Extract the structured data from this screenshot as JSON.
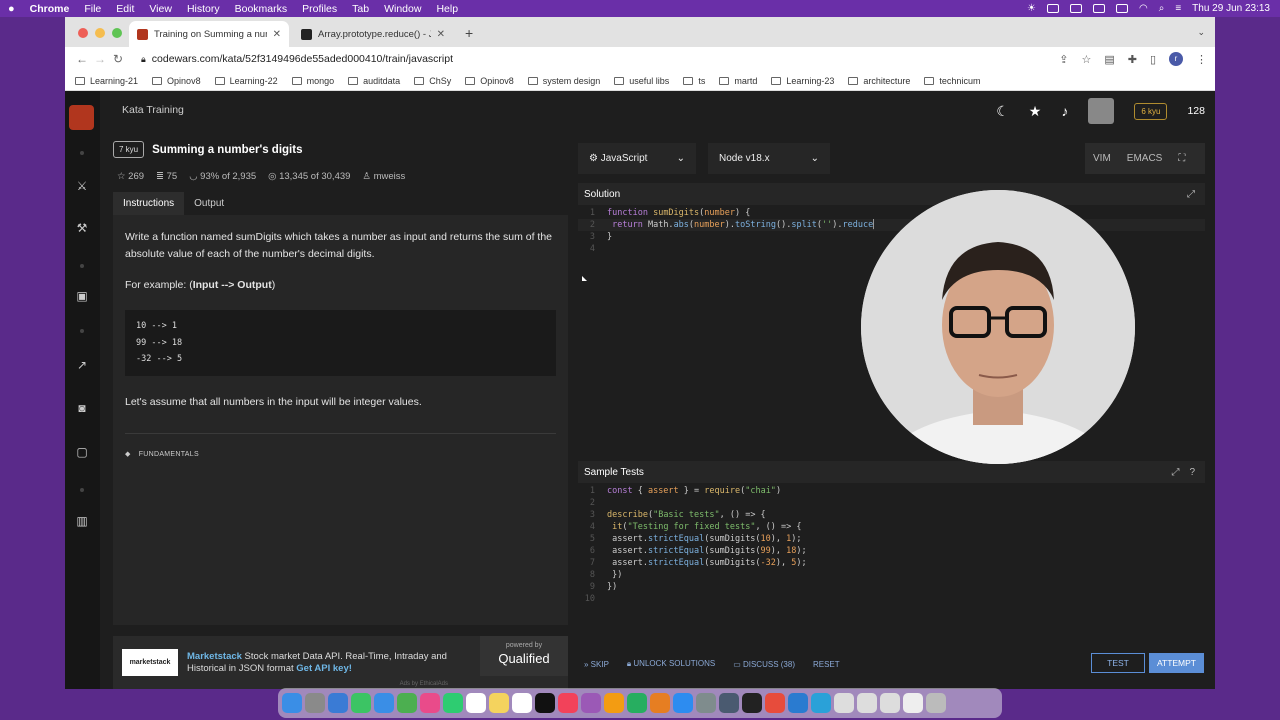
{
  "menubar": {
    "apple": "",
    "app": "Chrome",
    "items": [
      "File",
      "Edit",
      "View",
      "History",
      "Bookmarks",
      "Profiles",
      "Tab",
      "Window",
      "Help"
    ],
    "datetime": "Thu 29 Jun  23:13"
  },
  "tabs": [
    {
      "title": "Training on Summing a number",
      "active": true,
      "color": "#b1361e"
    },
    {
      "title": "Array.prototype.reduce() - Jav",
      "active": false,
      "color": "#222222"
    }
  ],
  "url": "codewars.com/kata/52f3149496de55aded000410/train/javascript",
  "profile_initial": "r",
  "bookmarks": [
    "Learning-21",
    "Opinov8",
    "Learning-22",
    "mongo",
    "auditdata",
    "ChSy",
    "Opinov8",
    "system design",
    "useful libs",
    "ts",
    "martd",
    "Learning-23",
    "architecture",
    "technicum"
  ],
  "header": {
    "breadcrumb": "Kata Training",
    "rank_badge": "6 kyu",
    "honor": "128"
  },
  "kata": {
    "kyu": "7 kyu",
    "title": "Summing a number's digits",
    "stars": "269",
    "collections": "75",
    "satisfaction": "93%",
    "of1": "of 2,935",
    "completed": "13,345",
    "of2": "of 30,439",
    "author": "mweiss"
  },
  "left_tabs": [
    "Instructions",
    "Output"
  ],
  "instructions": {
    "p1": "Write a function named sumDigits which takes a number as input and returns the sum of the absolute value of each of the number's decimal digits.",
    "example_prefix": "For example: (",
    "example_bold": "Input --> Output",
    "example_suffix": ")",
    "code": [
      "10 --> 1",
      "99 --> 18",
      "-32 --> 5"
    ],
    "p2": "Let's assume that all numbers in the input will be integer values.",
    "tag": "FUNDAMENTALS"
  },
  "ad": {
    "brand": "marketstack",
    "name": "Marketstack",
    "text": " Stock market Data API. Real-Time, Intraday and Historical in JSON format ",
    "cta": "Get API key!",
    "powered": "powered by",
    "qualified": "Qualified",
    "ethical": "Ads by EthicalAds"
  },
  "editor": {
    "language": "JavaScript",
    "runtime": "Node v18.x",
    "modes": [
      "VIM",
      "EMACS"
    ],
    "solution_label": "Solution",
    "tests_label": "Sample Tests"
  },
  "footer": {
    "skip": "SKIP",
    "unlock": "UNLOCK SOLUTIONS",
    "discuss": "DISCUSS (38)",
    "reset": "RESET",
    "test": "TEST",
    "attempt": "ATTEMPT"
  },
  "colors": {
    "codewars_red": "#b1361e",
    "accent_blue": "#5b8ed6"
  }
}
